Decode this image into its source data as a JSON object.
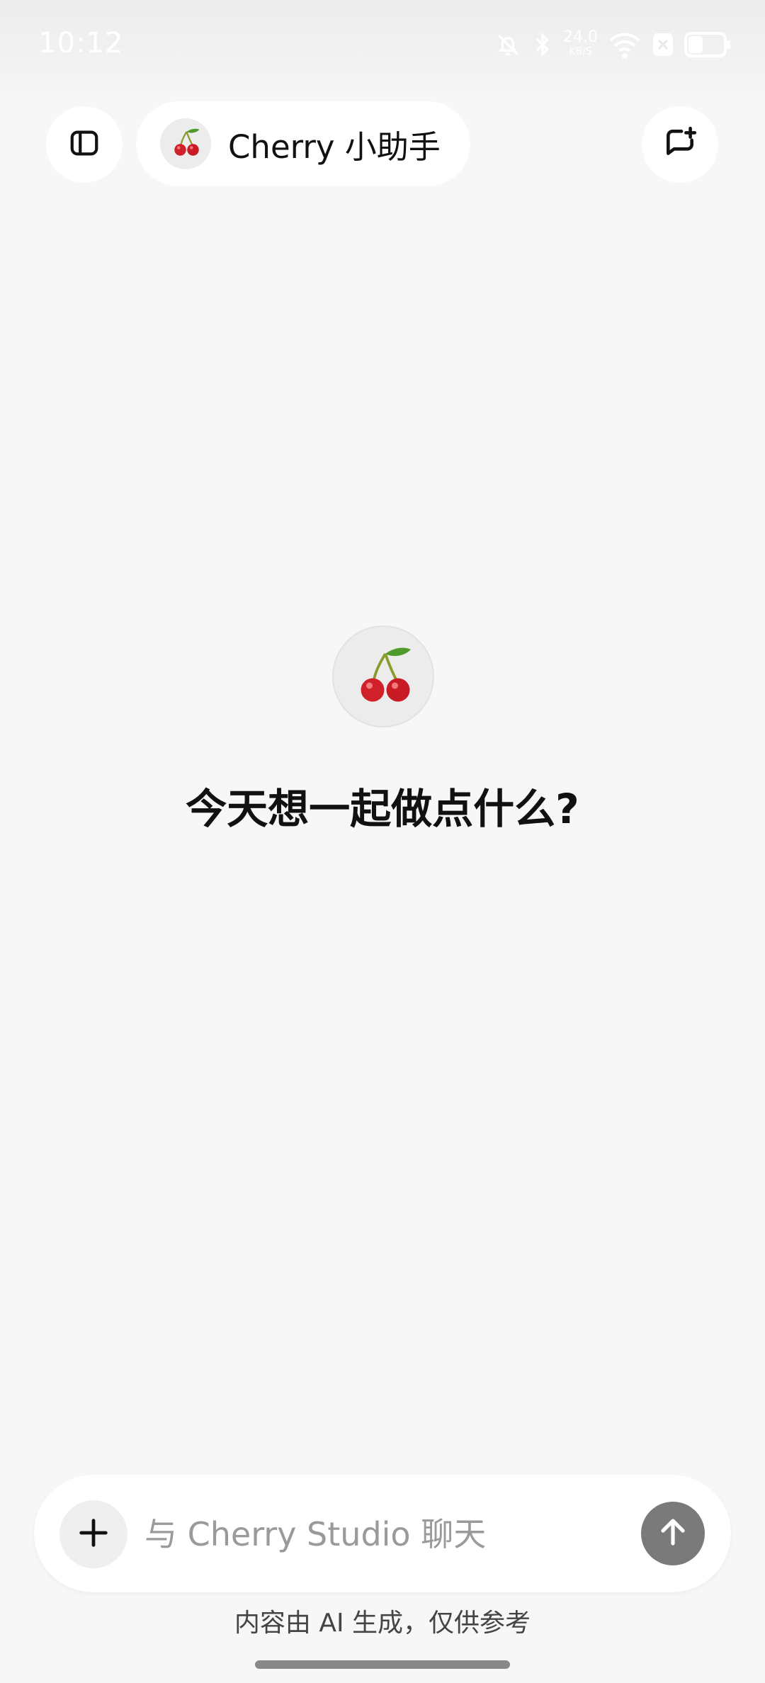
{
  "status_bar": {
    "time": "10:12",
    "net_speed_value": "24.0",
    "net_speed_unit": "KB/S"
  },
  "header": {
    "assistant_name": "Cherry 小助手",
    "sidebar_icon": "sidebar-toggle-icon",
    "new_chat_icon": "new-chat-icon"
  },
  "main": {
    "greeting": "今天想一起做点什么?"
  },
  "input": {
    "placeholder": "与 Cherry Studio 聊天",
    "value": ""
  },
  "footer": {
    "disclaimer": "内容由 AI 生成，仅供参考"
  },
  "colors": {
    "background": "#f7f7f7",
    "surface": "#ffffff",
    "send_button": "#7a7a7a",
    "cherry_red": "#d0202a",
    "leaf_green": "#4e9a2b"
  }
}
